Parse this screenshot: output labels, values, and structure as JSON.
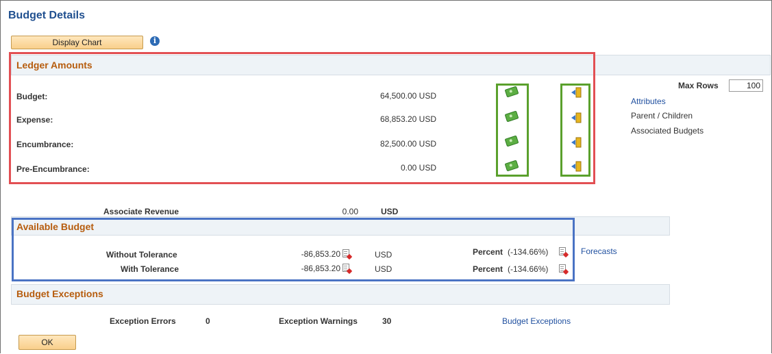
{
  "page": {
    "title": "Budget Details"
  },
  "toolbar": {
    "display_chart_label": "Display Chart",
    "info_icon": "i"
  },
  "ledger": {
    "title": "Ledger Amounts",
    "rows": [
      {
        "label": "Budget:",
        "amount": "64,500.00 USD"
      },
      {
        "label": "Expense:",
        "amount": "68,853.20 USD"
      },
      {
        "label": "Encumbrance:",
        "amount": "82,500.00 USD"
      },
      {
        "label": "Pre-Encumbrance:",
        "amount": "0.00 USD"
      }
    ],
    "money_icon": "money-icon",
    "drill_icon": "drill-down-icon"
  },
  "side": {
    "max_rows_label": "Max Rows",
    "max_rows_value": "100",
    "links": [
      "Attributes"
    ],
    "text_items": [
      "Parent / Children",
      "Associated Budgets"
    ]
  },
  "associate_revenue": {
    "label": "Associate Revenue",
    "amount": "0.00",
    "currency": "USD"
  },
  "available": {
    "title": "Available Budget",
    "rows": [
      {
        "label": "Without Tolerance",
        "amount": "-86,853.20",
        "currency": "USD",
        "percent_label": "Percent",
        "percent_value": "(-134.66%)"
      },
      {
        "label": "With Tolerance",
        "amount": "-86,853.20",
        "currency": "USD",
        "percent_label": "Percent",
        "percent_value": "(-134.66%)"
      }
    ],
    "forecasts_link": "Forecasts"
  },
  "exceptions": {
    "title": "Budget Exceptions",
    "errors_label": "Exception Errors",
    "errors_value": "0",
    "warnings_label": "Exception Warnings",
    "warnings_value": "30",
    "link": "Budget Exceptions"
  },
  "footer": {
    "ok_label": "OK"
  },
  "colors": {
    "title_blue": "#1f4f8f",
    "section_orange": "#b65c0d",
    "highlight_red": "#e24f53",
    "highlight_green": "#5aa02c",
    "highlight_blue": "#4a73c4"
  }
}
